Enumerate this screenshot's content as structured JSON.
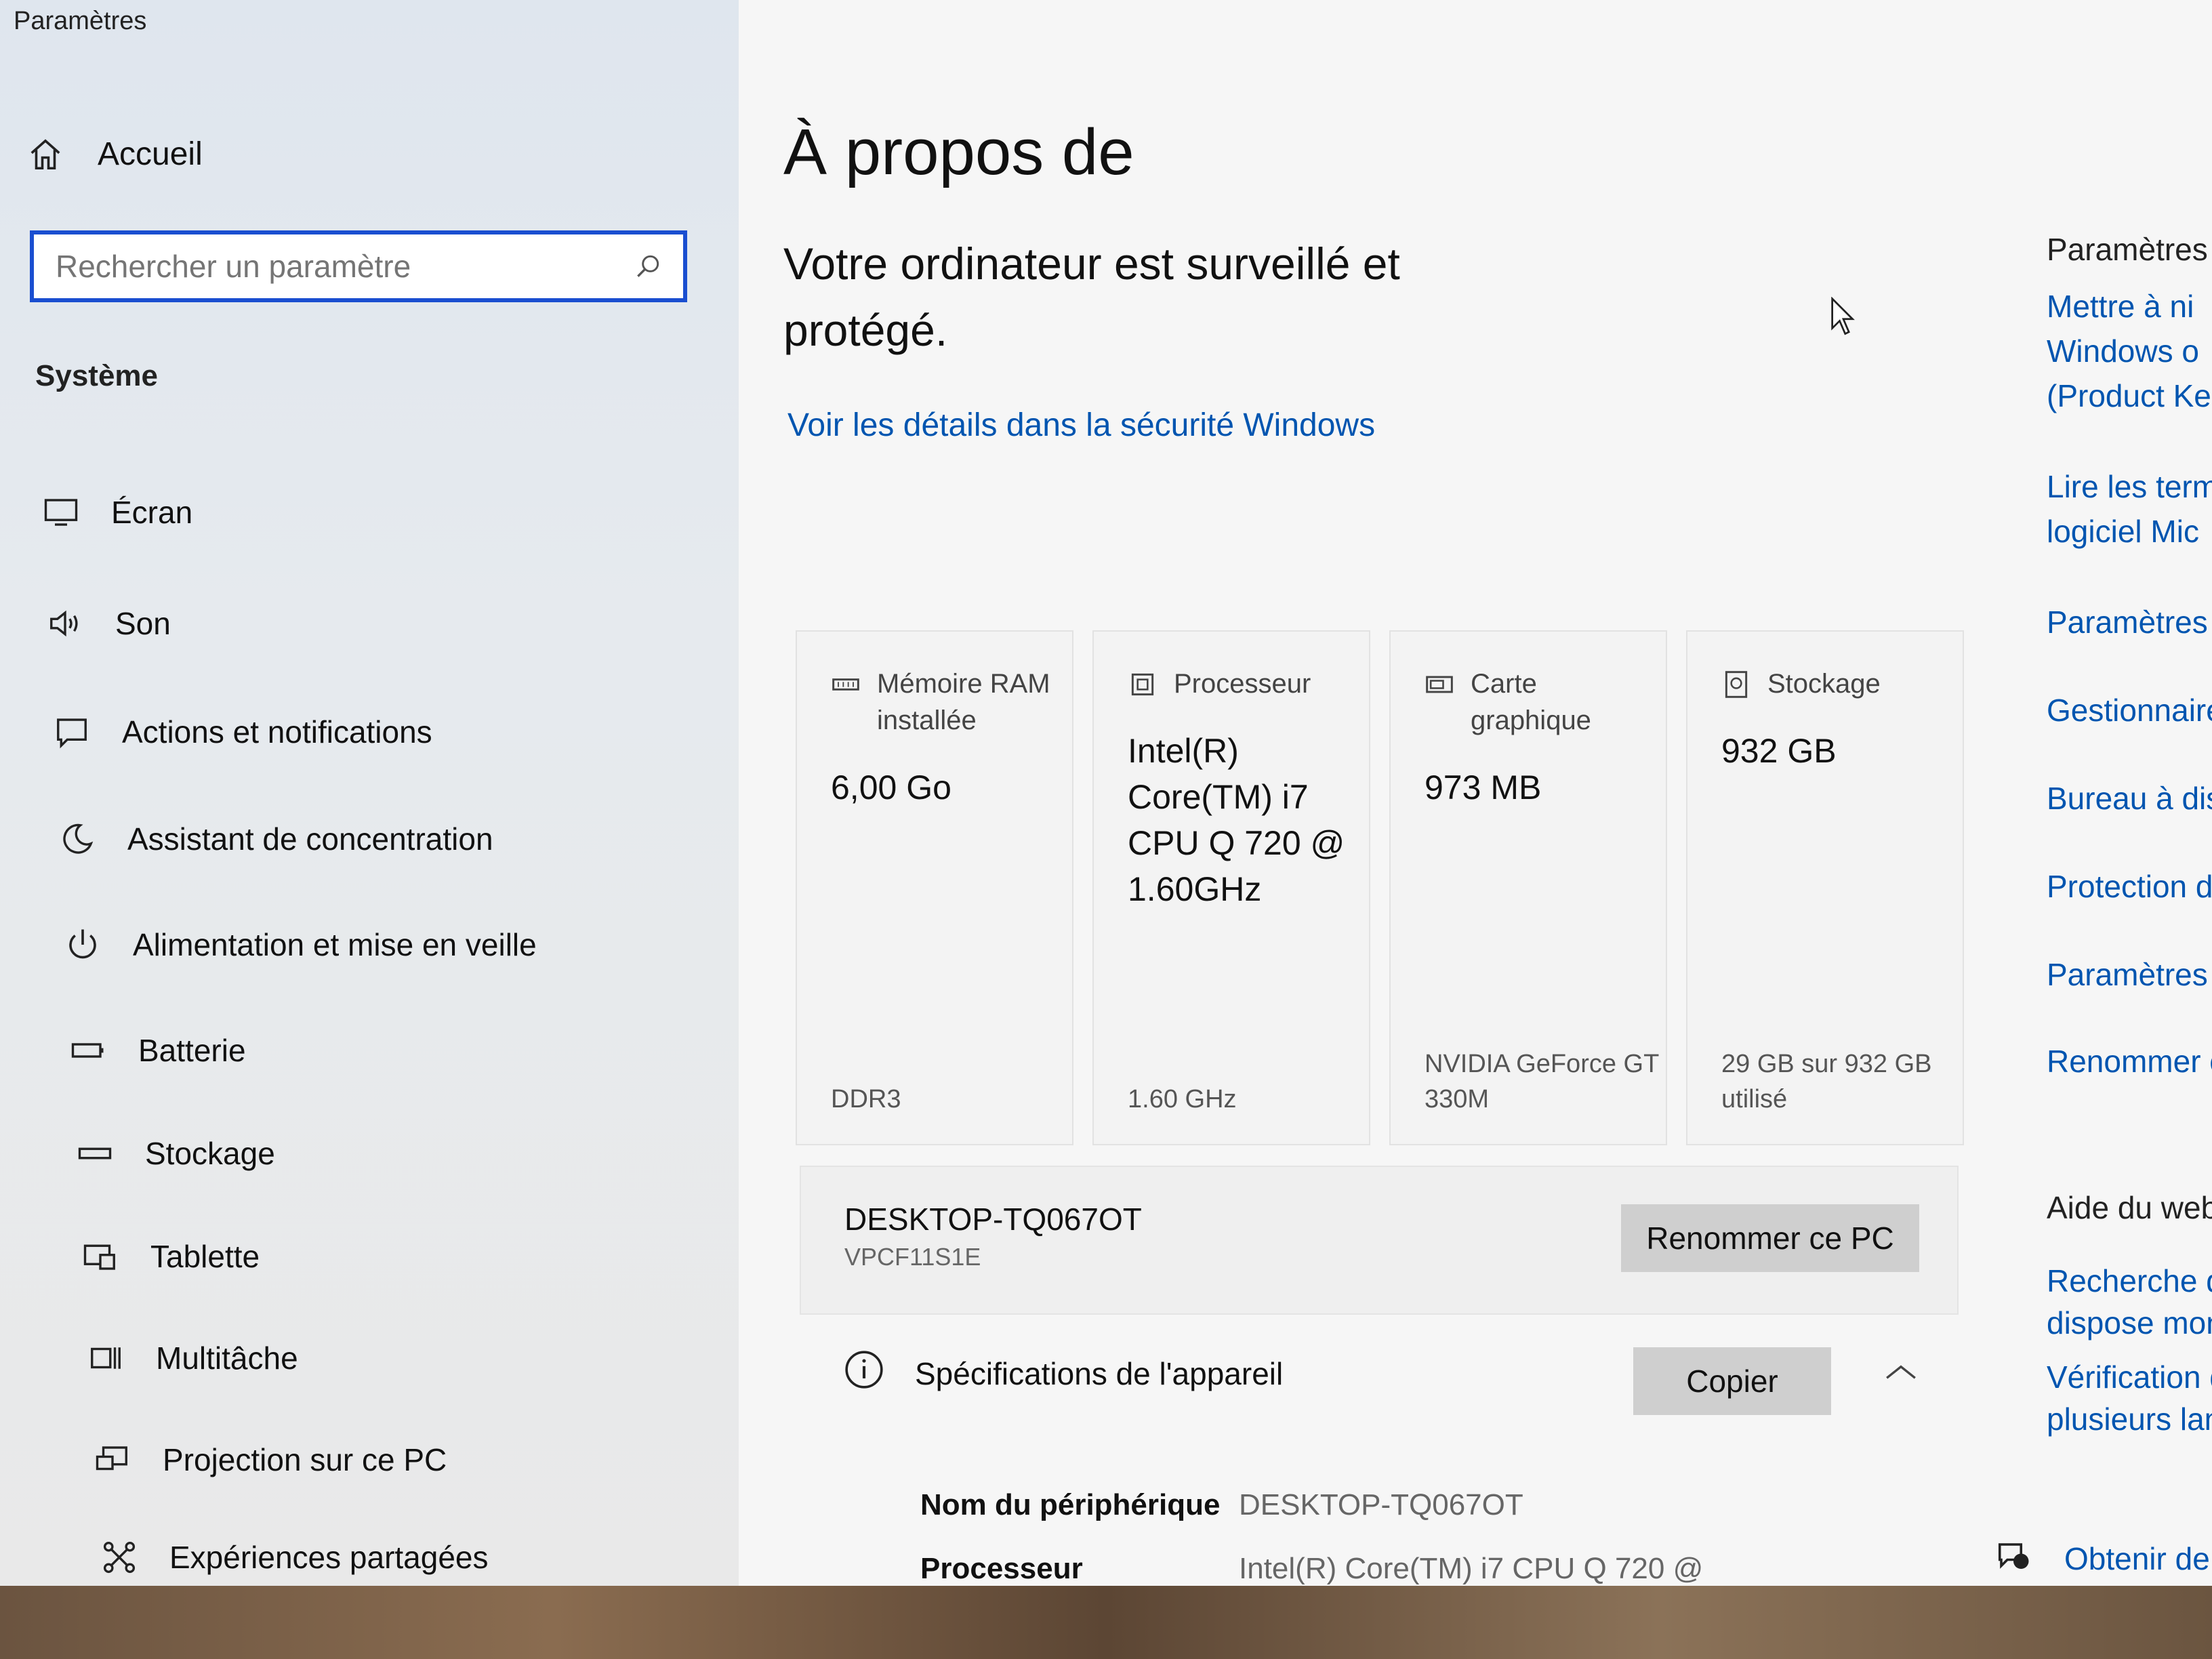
{
  "window": {
    "title": "Paramètres"
  },
  "sidebar": {
    "home_label": "Accueil",
    "search": {
      "placeholder": "Rechercher un paramètre"
    },
    "section_title": "Système",
    "items": [
      {
        "label": "Écran",
        "icon": "monitor-icon"
      },
      {
        "label": "Son",
        "icon": "speaker-icon"
      },
      {
        "label": "Actions et notifications",
        "icon": "notification-icon"
      },
      {
        "label": "Assistant de concentration",
        "icon": "moon-icon"
      },
      {
        "label": "Alimentation et mise en veille",
        "icon": "power-icon"
      },
      {
        "label": "Batterie",
        "icon": "battery-icon"
      },
      {
        "label": "Stockage",
        "icon": "storage-icon"
      },
      {
        "label": "Tablette",
        "icon": "tablet-icon"
      },
      {
        "label": "Multitâche",
        "icon": "multitask-icon"
      },
      {
        "label": "Projection sur ce PC",
        "icon": "projection-icon"
      },
      {
        "label": "Expériences partagées",
        "icon": "shared-icon"
      }
    ]
  },
  "main": {
    "title": "À propos de",
    "subtitle": "Votre ordinateur est surveillé et protégé.",
    "security_link": "Voir les détails dans la sécurité Windows",
    "cards": [
      {
        "label": "Mémoire RAM installée",
        "value": "6,00 Go",
        "footer": "DDR3",
        "icon": "ram-icon"
      },
      {
        "label": "Processeur",
        "value": "Intel(R) Core(TM) i7 CPU Q 720 @ 1.60GHz",
        "footer": "1.60 GHz",
        "icon": "cpu-icon"
      },
      {
        "label": "Carte graphique",
        "value": "973 MB",
        "footer": "NVIDIA GeForce GT 330M",
        "icon": "gpu-icon"
      },
      {
        "label": "Stockage",
        "value": "932 GB",
        "footer": "29 GB sur 932 GB utilisé",
        "icon": "disk-icon"
      }
    ],
    "pc": {
      "name": "DESKTOP-TQ067OT",
      "model": "VPCF11S1E",
      "rename_button": "Renommer ce PC"
    },
    "specs": {
      "title": "Spécifications de l'appareil",
      "copy_button": "Copier",
      "rows": [
        {
          "key": "Nom du périphérique",
          "value": "DESKTOP-TQ067OT"
        },
        {
          "key": "Processeur",
          "value": "Intel(R) Core(TM) i7 CPU Q 720 @"
        }
      ]
    }
  },
  "right_panel": {
    "heading": "Paramètres",
    "links": [
      "Mettre à ni",
      "Windows o",
      "(Product Ke",
      "Lire les term",
      "logiciel Mic",
      "Paramètres",
      "Gestionnaire",
      "Bureau à dist",
      "Protection du",
      "Paramètres av",
      "Renommer ce"
    ],
    "web_heading": "Aide du web",
    "web_links": [
      "Recherche du r",
      "dispose mon p",
      "Vérification de l",
      "plusieurs langu"
    ],
    "get_help": "Obtenir de"
  },
  "colors": {
    "accent": "#1a4ed0",
    "link": "#0055b0"
  }
}
